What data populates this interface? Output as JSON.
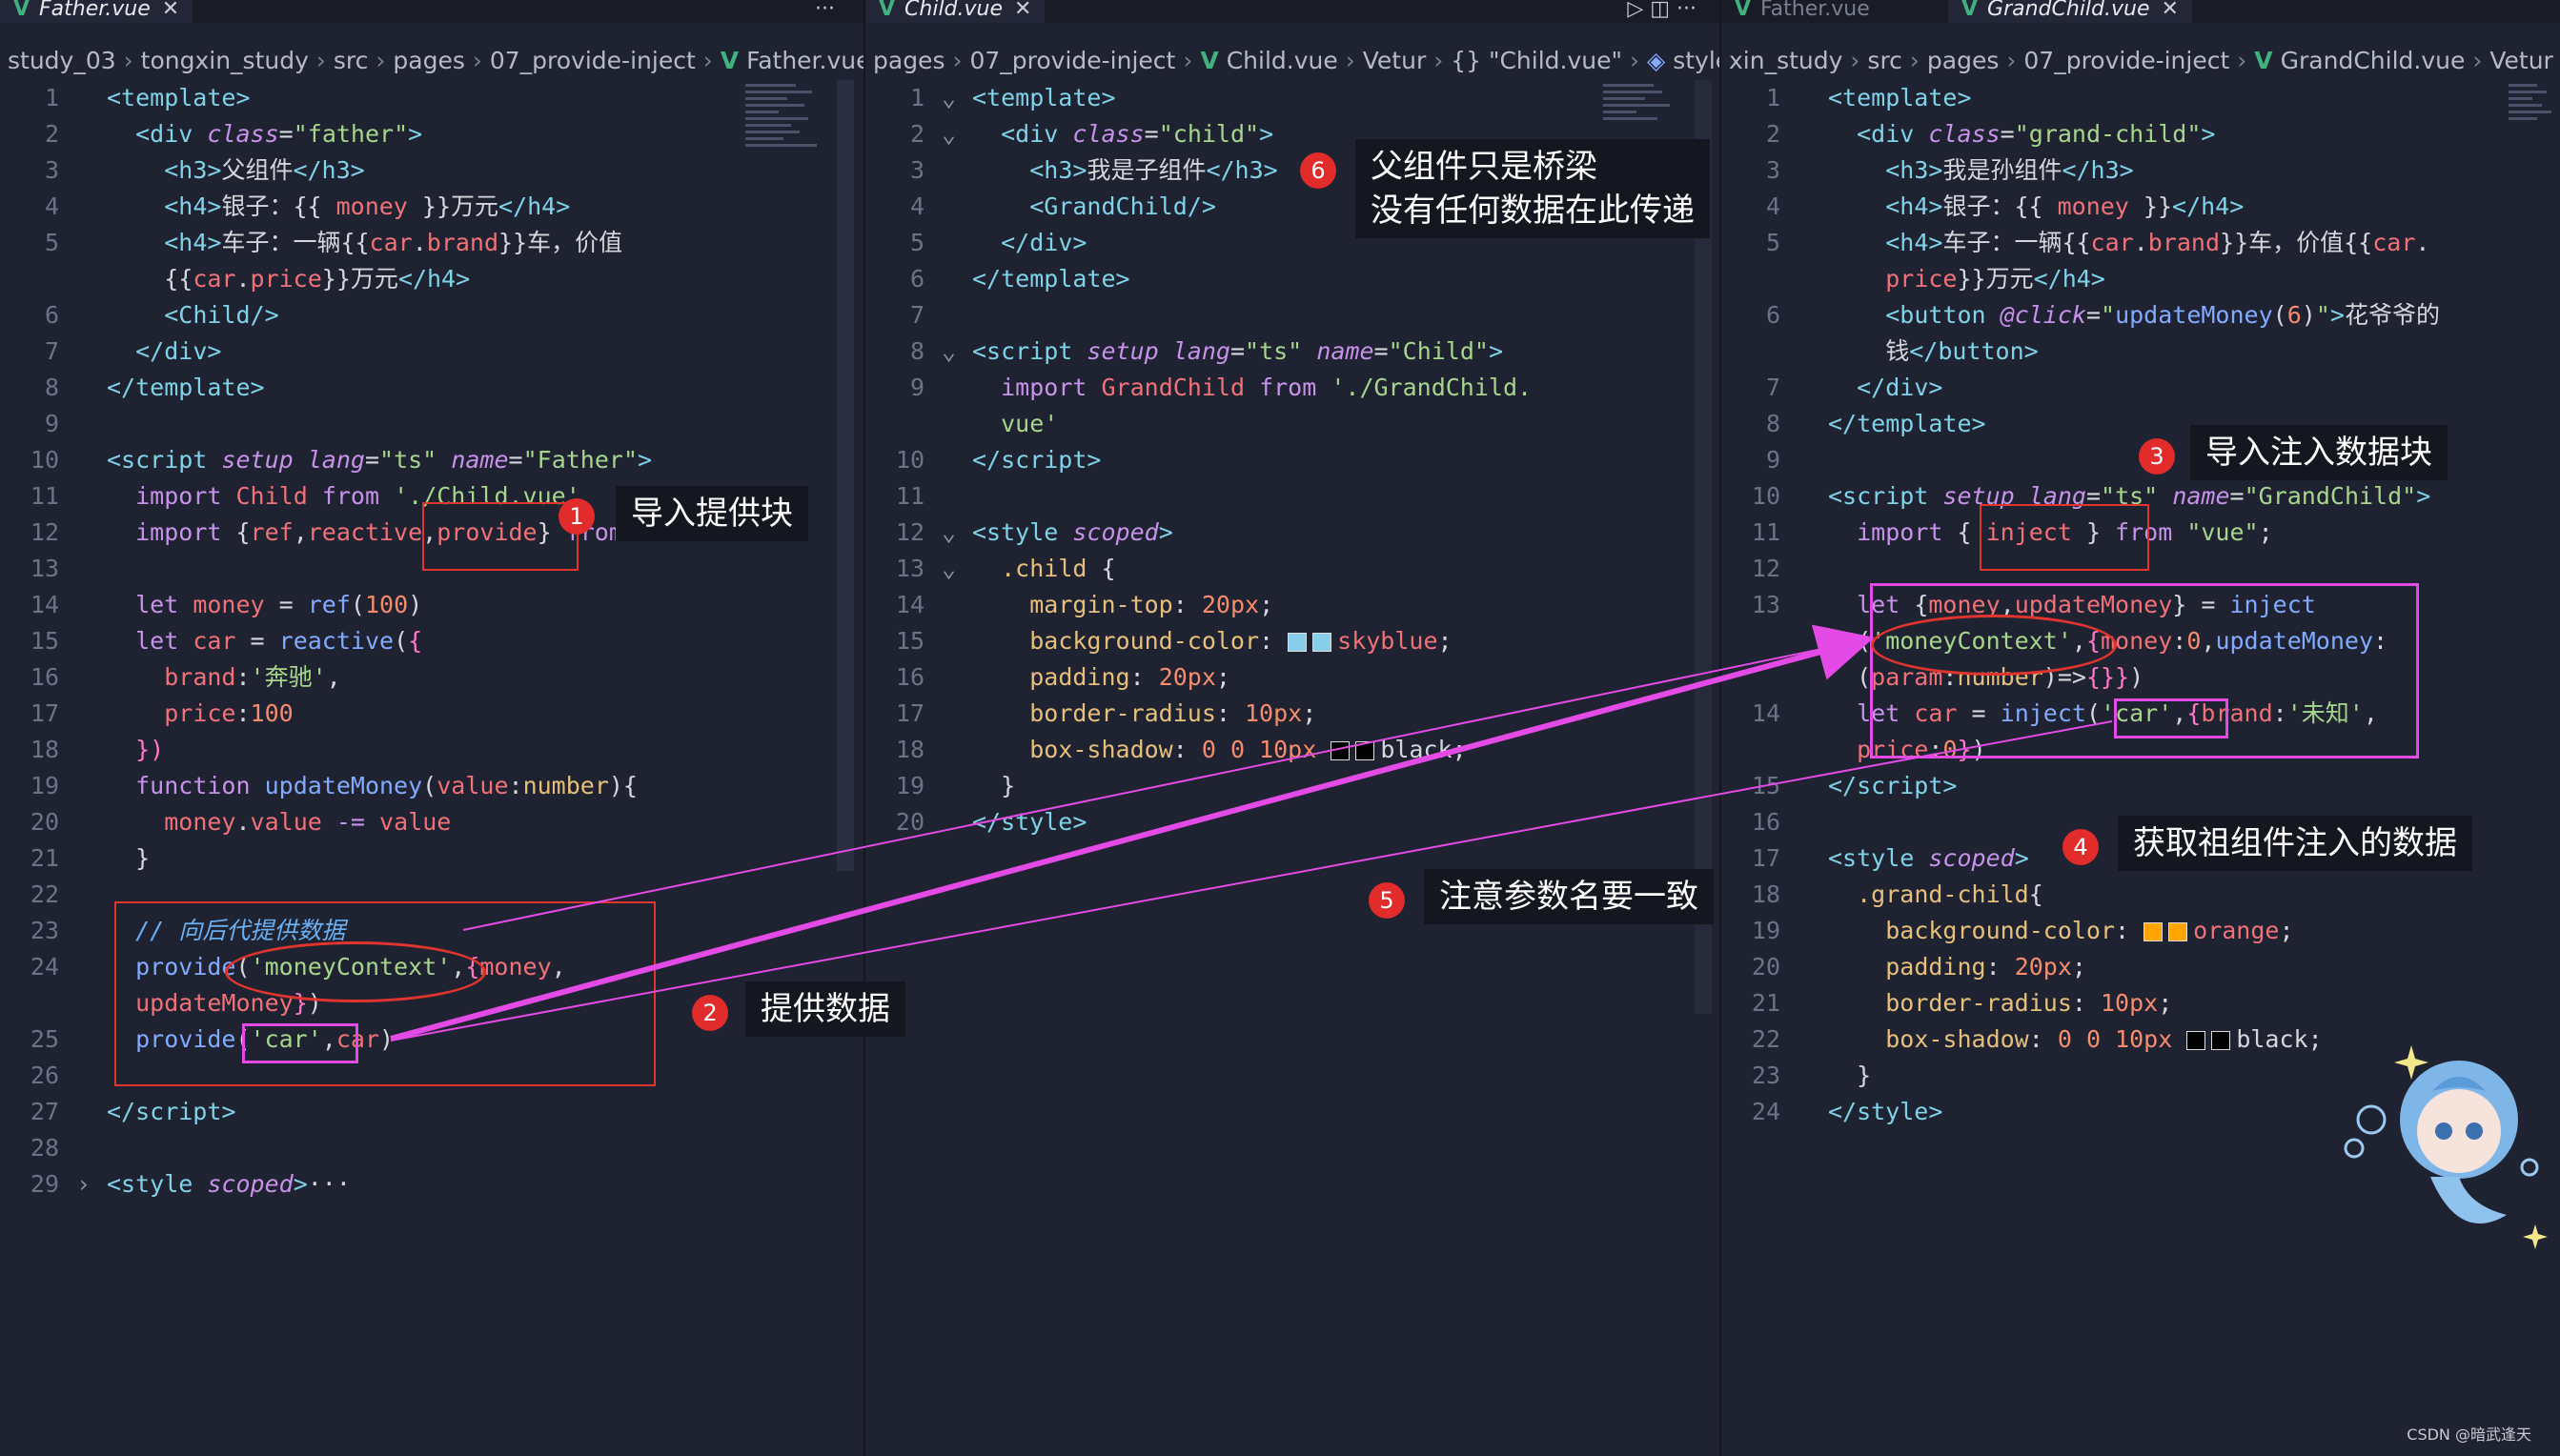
{
  "panes": {
    "father": {
      "tabs": [
        {
          "label": "Father.vue",
          "active": true
        }
      ],
      "actions_label": "···",
      "breadcrumb": [
        "study_03",
        "tongxin_study",
        "src",
        "pages",
        "07_provide-inject",
        "Father.vue"
      ],
      "lines": [
        {
          "n": "1",
          "html": "<span class='t-tag'>&lt;template&gt;</span>"
        },
        {
          "n": "2",
          "html": "  <span class='t-tag'>&lt;div</span> <span class='t-attr'>class</span>=<span class='t-str'>\"father\"</span><span class='t-tag'>&gt;</span>"
        },
        {
          "n": "3",
          "html": "    <span class='t-tag'>&lt;h3&gt;</span>父组件<span class='t-tag'>&lt;/h3&gt;</span>"
        },
        {
          "n": "4",
          "html": "    <span class='t-tag'>&lt;h4&gt;</span>银子：{{ <span class='t-var'>money</span> }}万元<span class='t-tag'>&lt;/h4&gt;</span>"
        },
        {
          "n": "5",
          "html": "    <span class='t-tag'>&lt;h4&gt;</span>车子：一辆{{<span class='t-var'>car</span>.<span class='t-var'>brand</span>}}车，价值"
        },
        {
          "n": "",
          "html": "    {{<span class='t-var'>car</span>.<span class='t-var'>price</span>}}万元<span class='t-tag'>&lt;/h4&gt;</span>"
        },
        {
          "n": "6",
          "html": "    <span class='t-tag'>&lt;Child/&gt;</span>"
        },
        {
          "n": "7",
          "html": "  <span class='t-tag'>&lt;/div&gt;</span>"
        },
        {
          "n": "8",
          "html": "<span class='t-tag'>&lt;/template&gt;</span>"
        },
        {
          "n": "9",
          "html": ""
        },
        {
          "n": "10",
          "html": "<span class='t-tag'>&lt;script</span> <span class='t-attr'>setup</span> <span class='t-attr'>lang</span>=<span class='t-str'>\"ts\"</span> <span class='t-attr'>name</span>=<span class='t-str'>\"Father\"</span><span class='t-tag'>&gt;</span>"
        },
        {
          "n": "11",
          "html": "  <span class='t-kw'>import</span> <span class='t-var'>Child</span> <span class='t-kw'>from</span> <span class='t-str'>'./Child.vue'</span>"
        },
        {
          "n": "12",
          "html": "  <span class='t-kw'>import</span> {<span class='t-var'>ref</span>,<span class='t-var'>reactive</span>,<span class='t-var'>provide</span>} <span class='t-kw'>from</span> <span class='t-str'>'vue'</span>"
        },
        {
          "n": "13",
          "html": ""
        },
        {
          "n": "14",
          "html": "  <span class='t-kw'>let</span> <span class='t-var'>money</span> = <span class='t-fn'>ref</span>(<span class='t-num'>100</span>)"
        },
        {
          "n": "15",
          "html": "  <span class='t-kw'>let</span> <span class='t-var'>car</span> = <span class='t-fn'>reactive</span>(<span class='t-pink'>{</span>"
        },
        {
          "n": "16",
          "html": "    <span class='t-var'>brand</span>:<span class='t-str'>'奔驰'</span>,"
        },
        {
          "n": "17",
          "html": "    <span class='t-var'>price</span>:<span class='t-num'>100</span>"
        },
        {
          "n": "18",
          "html": "  <span class='t-pink'>})</span>"
        },
        {
          "n": "19",
          "html": "  <span class='t-kw'>function</span> <span class='t-fn'>updateMoney</span>(<span class='t-var'>value</span>:<span class='t-prop'>number</span>){"
        },
        {
          "n": "20",
          "html": "    <span class='t-var'>money</span>.<span class='t-var'>value</span> <span class='t-kw'>-=</span> <span class='t-var'>value</span>"
        },
        {
          "n": "21",
          "html": "  }"
        },
        {
          "n": "22",
          "html": ""
        },
        {
          "n": "23",
          "html": "  <span class='t-cmt'>// 向后代提供数据</span>"
        },
        {
          "n": "24",
          "html": "  <span class='t-fn'>provide</span>(<span class='t-str'>'moneyContext'</span>,<span class='t-pink'>{</span><span class='t-var'>money</span>,"
        },
        {
          "n": "",
          "html": "  <span class='t-var'>updateMoney</span><span class='t-pink'>}</span>)"
        },
        {
          "n": "25",
          "html": "  <span class='t-fn'>provide</span>(<span class='t-str'>'car'</span>,<span class='t-var'>car</span>)"
        },
        {
          "n": "26",
          "html": ""
        },
        {
          "n": "27",
          "html": "<span class='t-tag'>&lt;/script&gt;</span>"
        },
        {
          "n": "28",
          "html": ""
        },
        {
          "n": "29",
          "html": "<span class='t-tag'>&lt;style</span> <span class='t-attr'>scoped</span><span class='t-tag'>&gt;</span>···"
        }
      ]
    },
    "child": {
      "tabs": [
        {
          "label": "Child.vue",
          "active": true
        }
      ],
      "actions_label": "▷  ◫  ···",
      "breadcrumb": [
        "pages",
        "07_provide-inject",
        "Child.vue",
        "Vetur",
        "{} \"Child.vue\"",
        "style"
      ],
      "lines": [
        {
          "n": "1",
          "html": "<span class='t-tag'>&lt;template&gt;</span>"
        },
        {
          "n": "2",
          "html": "  <span class='t-tag'>&lt;div</span> <span class='t-attr'>class</span>=<span class='t-str'>\"child\"</span><span class='t-tag'>&gt;</span>"
        },
        {
          "n": "3",
          "html": "    <span class='t-tag'>&lt;h3&gt;</span>我是子组件<span class='t-tag'>&lt;/h3&gt;</span>"
        },
        {
          "n": "4",
          "html": "    <span class='t-tag'>&lt;GrandChild/&gt;</span>"
        },
        {
          "n": "5",
          "html": "  <span class='t-tag'>&lt;/div&gt;</span>"
        },
        {
          "n": "6",
          "html": "<span class='t-tag'>&lt;/template&gt;</span>"
        },
        {
          "n": "7",
          "html": ""
        },
        {
          "n": "8",
          "html": "<span class='t-tag'>&lt;script</span> <span class='t-attr'>setup</span> <span class='t-attr'>lang</span>=<span class='t-str'>\"ts\"</span> <span class='t-attr'>name</span>=<span class='t-str'>\"Child\"</span><span class='t-tag'>&gt;</span>"
        },
        {
          "n": "9",
          "html": "  <span class='t-kw'>import</span> <span class='t-var'>GrandChild</span> <span class='t-kw'>from</span> <span class='t-str'>'./GrandChild.</span>"
        },
        {
          "n": "",
          "html": "  <span class='t-str'>vue'</span>"
        },
        {
          "n": "10",
          "html": "<span class='t-tag'>&lt;/script&gt;</span>"
        },
        {
          "n": "11",
          "html": ""
        },
        {
          "n": "12",
          "html": "<span class='t-tag'>&lt;style</span> <span class='t-attr'>scoped</span><span class='t-tag'>&gt;</span>"
        },
        {
          "n": "13",
          "html": "  <span class='t-sel'>.child</span> {"
        },
        {
          "n": "14",
          "html": "    <span class='t-prop'>margin-top</span>: <span class='t-num'>20px</span>;"
        },
        {
          "n": "15",
          "html": "    <span class='t-prop'>background-color</span>: <span class='swatch' style='background:#87ceeb'></span><span class='swatch' style='background:#87ceeb'></span><span class='t-var'>skyblue</span>;"
        },
        {
          "n": "16",
          "html": "    <span class='t-prop'>padding</span>: <span class='t-num'>20px</span>;"
        },
        {
          "n": "17",
          "html": "    <span class='t-prop'>border-radius</span>: <span class='t-num'>10px</span>;"
        },
        {
          "n": "18",
          "html": "    <span class='t-prop'>box-shadow</span>: <span class='t-num'>0 0 10px</span> <span class='swatch' style='background:#000'></span><span class='swatch' style='background:#000'></span>black;"
        },
        {
          "n": "19",
          "html": "  }"
        },
        {
          "n": "20",
          "html": "<span class='t-tag'>&lt;/style&gt;</span>"
        }
      ]
    },
    "grand": {
      "tabs": [
        {
          "label": "Father.vue",
          "active": false
        },
        {
          "label": "GrandChild.vue",
          "active": true
        }
      ],
      "breadcrumb": [
        "xin_study",
        "src",
        "pages",
        "07_provide-inject",
        "GrandChild.vue",
        "Vetur"
      ],
      "lines": [
        {
          "n": "1",
          "html": "<span class='t-tag'>&lt;template&gt;</span>"
        },
        {
          "n": "2",
          "html": "  <span class='t-tag'>&lt;div</span> <span class='t-attr'>class</span>=<span class='t-str'>\"grand-child\"</span><span class='t-tag'>&gt;</span>"
        },
        {
          "n": "3",
          "html": "    <span class='t-tag'>&lt;h3&gt;</span>我是孙组件<span class='t-tag'>&lt;/h3&gt;</span>"
        },
        {
          "n": "4",
          "html": "    <span class='t-tag'>&lt;h4&gt;</span>银子：{{ <span class='t-var'>money</span> }}<span class='t-tag'>&lt;/h4&gt;</span>"
        },
        {
          "n": "5",
          "html": "    <span class='t-tag'>&lt;h4&gt;</span>车子：一辆{{<span class='t-var'>car</span>.<span class='t-var'>brand</span>}}车，价值{{<span class='t-var'>car</span>."
        },
        {
          "n": "",
          "html": "    <span class='t-var'>price</span>}}万元<span class='t-tag'>&lt;/h4&gt;</span>"
        },
        {
          "n": "6",
          "html": "    <span class='t-tag'>&lt;button</span> <span class='t-attr'>@click</span>=<span class='t-str'>\"</span><span class='t-fn'>updateMoney</span>(<span class='t-num'>6</span>)<span class='t-str'>\"</span><span class='t-tag'>&gt;</span>花爷爷的"
        },
        {
          "n": "",
          "html": "    钱<span class='t-tag'>&lt;/button&gt;</span>"
        },
        {
          "n": "7",
          "html": "  <span class='t-tag'>&lt;/div&gt;</span>"
        },
        {
          "n": "8",
          "html": "<span class='t-tag'>&lt;/template&gt;</span>"
        },
        {
          "n": "9",
          "html": ""
        },
        {
          "n": "10",
          "html": "<span class='t-tag'>&lt;script</span> <span class='t-attr'>setup</span> <span class='t-attr'>lang</span>=<span class='t-str'>\"ts\"</span> <span class='t-attr'>name</span>=<span class='t-str'>\"GrandChild\"</span><span class='t-tag'>&gt;</span>"
        },
        {
          "n": "11",
          "html": "  <span class='t-kw'>import</span> { <span class='t-var'>inject</span> } <span class='t-kw'>from</span> <span class='t-str'>\"vue\"</span>;"
        },
        {
          "n": "12",
          "html": ""
        },
        {
          "n": "13",
          "html": "  <span class='t-kw'>let</span> {<span class='t-var'>money</span>,<span class='t-var'>updateMoney</span>} = <span class='t-fn'>inject</span>"
        },
        {
          "n": "",
          "html": "  (<span class='t-str'>'moneyContext'</span>,<span class='t-pink'>{</span><span class='t-var'>money</span>:<span class='t-num'>0</span>,<span class='t-fn'>updateMoney</span>:"
        },
        {
          "n": "",
          "html": "  (<span class='t-var'>param</span>:<span class='t-prop'>number</span>)=&gt;<span class='t-pink'>{}}</span>)"
        },
        {
          "n": "14",
          "html": "  <span class='t-kw'>let</span> <span class='t-var'>car</span> = <span class='t-fn'>inject</span>(<span class='t-str'>'car'</span>,<span class='t-pink'>{</span><span class='t-var'>brand</span>:<span class='t-str'>'未知'</span>,"
        },
        {
          "n": "",
          "html": "  <span class='t-var'>price</span>:<span class='t-num'>0</span><span class='t-pink'>}</span>)"
        },
        {
          "n": "15",
          "html": "<span class='t-tag'>&lt;/script&gt;</span>"
        },
        {
          "n": "16",
          "html": ""
        },
        {
          "n": "17",
          "html": "<span class='t-tag'>&lt;style</span> <span class='t-attr'>scoped</span><span class='t-tag'>&gt;</span>"
        },
        {
          "n": "18",
          "html": "  <span class='t-sel'>.grand-child</span>{"
        },
        {
          "n": "19",
          "html": "    <span class='t-prop'>background-color</span>: <span class='swatch' style='background:#ffa500'></span><span class='swatch' style='background:#ffa500'></span><span class='t-var'>orange</span>;"
        },
        {
          "n": "20",
          "html": "    <span class='t-prop'>padding</span>: <span class='t-num'>20px</span>;"
        },
        {
          "n": "21",
          "html": "    <span class='t-prop'>border-radius</span>: <span class='t-num'>10px</span>;"
        },
        {
          "n": "22",
          "html": "    <span class='t-prop'>box-shadow</span>: <span class='t-num'>0 0 10px</span> <span class='swatch' style='background:#000'></span><span class='swatch' style='background:#000'></span>black;"
        },
        {
          "n": "23",
          "html": "  }"
        },
        {
          "n": "24",
          "html": "<span class='t-tag'>&lt;/style&gt;</span>"
        }
      ]
    }
  },
  "annotations": {
    "a1": {
      "badge": "1",
      "text": "导入提供块"
    },
    "a2": {
      "badge": "2",
      "text": "提供数据"
    },
    "a3": {
      "badge": "3",
      "text": "导入注入数据块"
    },
    "a4": {
      "badge": "4",
      "text": "获取祖组件注入的数据"
    },
    "a5": {
      "badge": "5",
      "text": "注意参数名要一致"
    },
    "a6": {
      "badge": "6",
      "text": "父组件只是桥梁\n没有任何数据在此传递"
    }
  },
  "watermark": "CSDN @暗武逢天",
  "colors": {
    "accent_arrow": "#e44ae6",
    "annotation_red": "#e0352d",
    "vue_green": "#3fb27f"
  }
}
